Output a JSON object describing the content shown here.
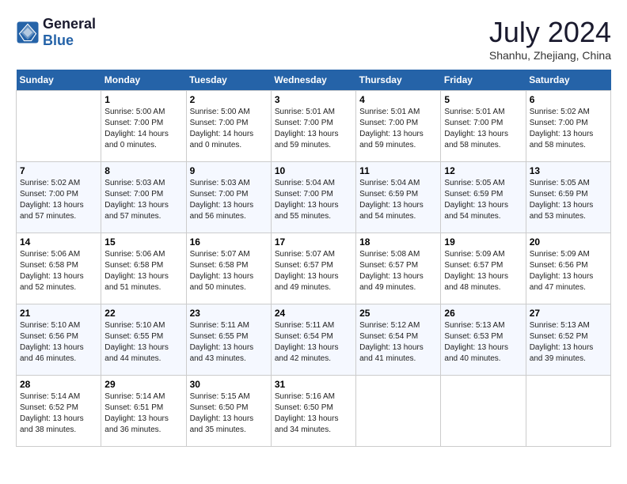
{
  "header": {
    "logo_general": "General",
    "logo_blue": "Blue",
    "month": "July 2024",
    "location": "Shanhu, Zhejiang, China"
  },
  "calendar": {
    "weekdays": [
      "Sunday",
      "Monday",
      "Tuesday",
      "Wednesday",
      "Thursday",
      "Friday",
      "Saturday"
    ],
    "weeks": [
      [
        {
          "day": "",
          "sunrise": "",
          "sunset": "",
          "daylight": ""
        },
        {
          "day": "1",
          "sunrise": "Sunrise: 5:00 AM",
          "sunset": "Sunset: 7:00 PM",
          "daylight": "Daylight: 14 hours and 0 minutes."
        },
        {
          "day": "2",
          "sunrise": "Sunrise: 5:00 AM",
          "sunset": "Sunset: 7:00 PM",
          "daylight": "Daylight: 14 hours and 0 minutes."
        },
        {
          "day": "3",
          "sunrise": "Sunrise: 5:01 AM",
          "sunset": "Sunset: 7:00 PM",
          "daylight": "Daylight: 13 hours and 59 minutes."
        },
        {
          "day": "4",
          "sunrise": "Sunrise: 5:01 AM",
          "sunset": "Sunset: 7:00 PM",
          "daylight": "Daylight: 13 hours and 59 minutes."
        },
        {
          "day": "5",
          "sunrise": "Sunrise: 5:01 AM",
          "sunset": "Sunset: 7:00 PM",
          "daylight": "Daylight: 13 hours and 58 minutes."
        },
        {
          "day": "6",
          "sunrise": "Sunrise: 5:02 AM",
          "sunset": "Sunset: 7:00 PM",
          "daylight": "Daylight: 13 hours and 58 minutes."
        }
      ],
      [
        {
          "day": "7",
          "sunrise": "Sunrise: 5:02 AM",
          "sunset": "Sunset: 7:00 PM",
          "daylight": "Daylight: 13 hours and 57 minutes."
        },
        {
          "day": "8",
          "sunrise": "Sunrise: 5:03 AM",
          "sunset": "Sunset: 7:00 PM",
          "daylight": "Daylight: 13 hours and 57 minutes."
        },
        {
          "day": "9",
          "sunrise": "Sunrise: 5:03 AM",
          "sunset": "Sunset: 7:00 PM",
          "daylight": "Daylight: 13 hours and 56 minutes."
        },
        {
          "day": "10",
          "sunrise": "Sunrise: 5:04 AM",
          "sunset": "Sunset: 7:00 PM",
          "daylight": "Daylight: 13 hours and 55 minutes."
        },
        {
          "day": "11",
          "sunrise": "Sunrise: 5:04 AM",
          "sunset": "Sunset: 6:59 PM",
          "daylight": "Daylight: 13 hours and 54 minutes."
        },
        {
          "day": "12",
          "sunrise": "Sunrise: 5:05 AM",
          "sunset": "Sunset: 6:59 PM",
          "daylight": "Daylight: 13 hours and 54 minutes."
        },
        {
          "day": "13",
          "sunrise": "Sunrise: 5:05 AM",
          "sunset": "Sunset: 6:59 PM",
          "daylight": "Daylight: 13 hours and 53 minutes."
        }
      ],
      [
        {
          "day": "14",
          "sunrise": "Sunrise: 5:06 AM",
          "sunset": "Sunset: 6:58 PM",
          "daylight": "Daylight: 13 hours and 52 minutes."
        },
        {
          "day": "15",
          "sunrise": "Sunrise: 5:06 AM",
          "sunset": "Sunset: 6:58 PM",
          "daylight": "Daylight: 13 hours and 51 minutes."
        },
        {
          "day": "16",
          "sunrise": "Sunrise: 5:07 AM",
          "sunset": "Sunset: 6:58 PM",
          "daylight": "Daylight: 13 hours and 50 minutes."
        },
        {
          "day": "17",
          "sunrise": "Sunrise: 5:07 AM",
          "sunset": "Sunset: 6:57 PM",
          "daylight": "Daylight: 13 hours and 49 minutes."
        },
        {
          "day": "18",
          "sunrise": "Sunrise: 5:08 AM",
          "sunset": "Sunset: 6:57 PM",
          "daylight": "Daylight: 13 hours and 49 minutes."
        },
        {
          "day": "19",
          "sunrise": "Sunrise: 5:09 AM",
          "sunset": "Sunset: 6:57 PM",
          "daylight": "Daylight: 13 hours and 48 minutes."
        },
        {
          "day": "20",
          "sunrise": "Sunrise: 5:09 AM",
          "sunset": "Sunset: 6:56 PM",
          "daylight": "Daylight: 13 hours and 47 minutes."
        }
      ],
      [
        {
          "day": "21",
          "sunrise": "Sunrise: 5:10 AM",
          "sunset": "Sunset: 6:56 PM",
          "daylight": "Daylight: 13 hours and 46 minutes."
        },
        {
          "day": "22",
          "sunrise": "Sunrise: 5:10 AM",
          "sunset": "Sunset: 6:55 PM",
          "daylight": "Daylight: 13 hours and 44 minutes."
        },
        {
          "day": "23",
          "sunrise": "Sunrise: 5:11 AM",
          "sunset": "Sunset: 6:55 PM",
          "daylight": "Daylight: 13 hours and 43 minutes."
        },
        {
          "day": "24",
          "sunrise": "Sunrise: 5:11 AM",
          "sunset": "Sunset: 6:54 PM",
          "daylight": "Daylight: 13 hours and 42 minutes."
        },
        {
          "day": "25",
          "sunrise": "Sunrise: 5:12 AM",
          "sunset": "Sunset: 6:54 PM",
          "daylight": "Daylight: 13 hours and 41 minutes."
        },
        {
          "day": "26",
          "sunrise": "Sunrise: 5:13 AM",
          "sunset": "Sunset: 6:53 PM",
          "daylight": "Daylight: 13 hours and 40 minutes."
        },
        {
          "day": "27",
          "sunrise": "Sunrise: 5:13 AM",
          "sunset": "Sunset: 6:52 PM",
          "daylight": "Daylight: 13 hours and 39 minutes."
        }
      ],
      [
        {
          "day": "28",
          "sunrise": "Sunrise: 5:14 AM",
          "sunset": "Sunset: 6:52 PM",
          "daylight": "Daylight: 13 hours and 38 minutes."
        },
        {
          "day": "29",
          "sunrise": "Sunrise: 5:14 AM",
          "sunset": "Sunset: 6:51 PM",
          "daylight": "Daylight: 13 hours and 36 minutes."
        },
        {
          "day": "30",
          "sunrise": "Sunrise: 5:15 AM",
          "sunset": "Sunset: 6:50 PM",
          "daylight": "Daylight: 13 hours and 35 minutes."
        },
        {
          "day": "31",
          "sunrise": "Sunrise: 5:16 AM",
          "sunset": "Sunset: 6:50 PM",
          "daylight": "Daylight: 13 hours and 34 minutes."
        },
        {
          "day": "",
          "sunrise": "",
          "sunset": "",
          "daylight": ""
        },
        {
          "day": "",
          "sunrise": "",
          "sunset": "",
          "daylight": ""
        },
        {
          "day": "",
          "sunrise": "",
          "sunset": "",
          "daylight": ""
        }
      ]
    ]
  }
}
